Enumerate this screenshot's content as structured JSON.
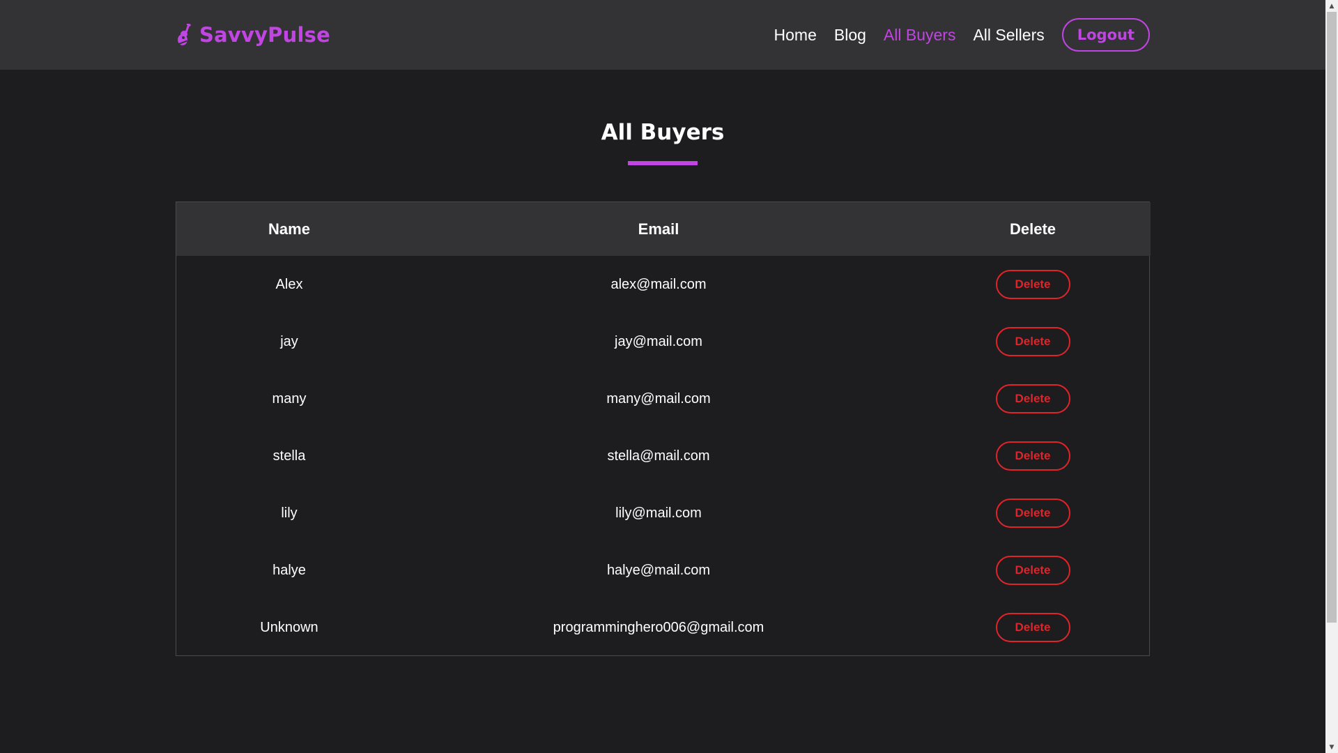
{
  "brand": {
    "name": "SavvyPulse",
    "icon": "guitar-icon",
    "color": "#c045e2"
  },
  "nav": {
    "links": [
      {
        "label": "Home",
        "active": false
      },
      {
        "label": "Blog",
        "active": false
      },
      {
        "label": "All Buyers",
        "active": true
      },
      {
        "label": "All Sellers",
        "active": false
      }
    ],
    "logout_label": "Logout"
  },
  "page": {
    "title": "All Buyers"
  },
  "table": {
    "headers": {
      "name": "Name",
      "email": "Email",
      "delete": "Delete"
    },
    "rows": [
      {
        "name": "Alex",
        "email": "alex@mail.com",
        "action": "Delete"
      },
      {
        "name": "jay",
        "email": "jay@mail.com",
        "action": "Delete"
      },
      {
        "name": "many",
        "email": "many@mail.com",
        "action": "Delete"
      },
      {
        "name": "stella",
        "email": "stella@mail.com",
        "action": "Delete"
      },
      {
        "name": "lily",
        "email": "lily@mail.com",
        "action": "Delete"
      },
      {
        "name": "halye",
        "email": "halye@mail.com",
        "action": "Delete"
      },
      {
        "name": "Unknown",
        "email": "programminghero006@gmail.com",
        "action": "Delete"
      }
    ]
  },
  "colors": {
    "accent": "#c045e2",
    "danger": "#e0242a",
    "background": "#1d1d1f",
    "navbar": "#333335"
  }
}
